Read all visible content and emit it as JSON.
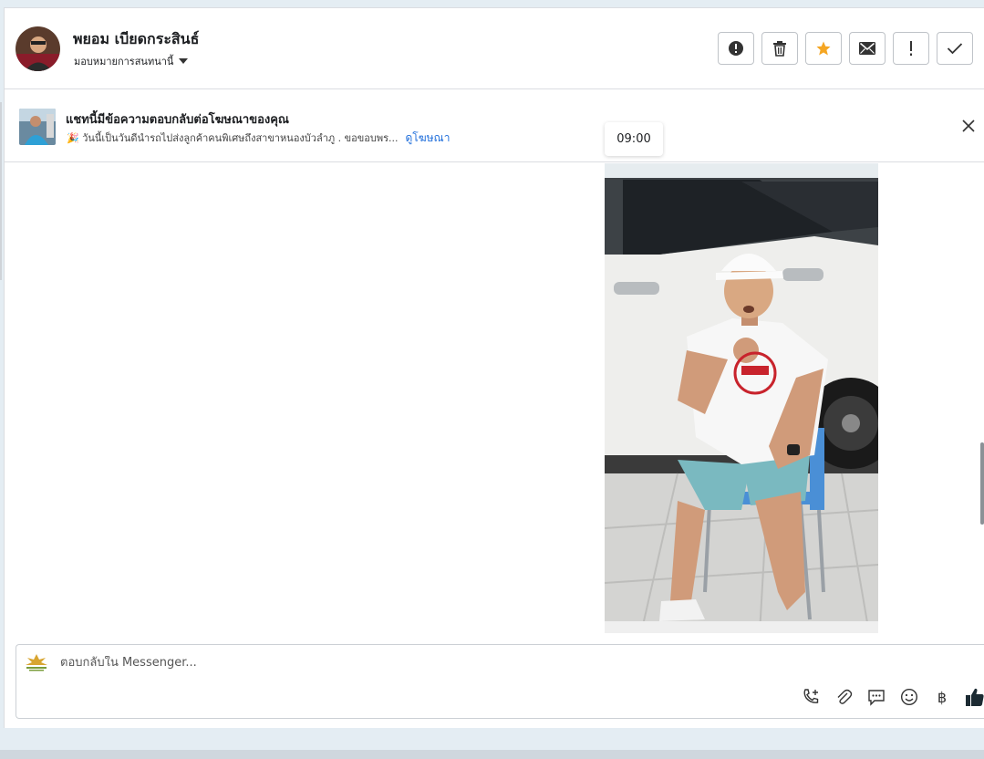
{
  "contact": {
    "name": "พยอม เบียดกระสินธ์",
    "assign_label": "มอบหมายการสนทนานี้"
  },
  "header_actions": [
    {
      "icon": "alert-circle-icon"
    },
    {
      "icon": "trash-icon"
    },
    {
      "icon": "star-icon",
      "color": "#f5a623"
    },
    {
      "icon": "envelope-icon"
    },
    {
      "icon": "exclamation-icon"
    },
    {
      "icon": "check-icon"
    }
  ],
  "ad_banner": {
    "title": "แชทนี้มีข้อความตอบกลับต่อโฆษณาของคุณ",
    "preview": "🎉 วันนี้เป็นวันดีนำรถไปส่งลูกค้าคนพิเศษถึงสาขาหนองบัวลำภู . ขอขอบพร...",
    "link": "ดูโฆษณา"
  },
  "message": {
    "time": "09:00"
  },
  "composer": {
    "placeholder": "ตอบกลับใน Messenger...",
    "tools": [
      "phone-add-icon",
      "paperclip-icon",
      "chat-bubble-icon",
      "smiley-icon",
      "baht-icon",
      "thumbs-up-icon"
    ],
    "baht_symbol": "฿"
  },
  "colors": {
    "link": "#216fdb",
    "star": "#f5a623",
    "border": "#dadde1"
  }
}
